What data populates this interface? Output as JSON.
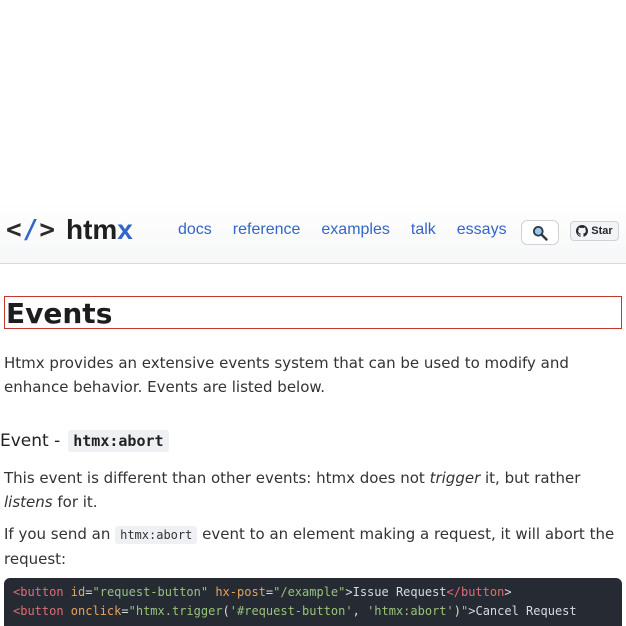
{
  "header": {
    "logo_bracket_open": "<",
    "logo_slash": "/",
    "logo_bracket_close": ">",
    "logo_name_main": "htm",
    "logo_name_accent": "x",
    "nav": [
      "docs",
      "reference",
      "examples",
      "talk",
      "essays"
    ],
    "star_label": "Star",
    "search_icon": "magnifier-icon",
    "github_icon": "github-icon"
  },
  "main": {
    "title": "Events",
    "intro": "Htmx provides an extensive events system that can be used to modify and enhance behavior. Events are listed below.",
    "event": {
      "heading_prefix": "Event -",
      "heading_code": "htmx:abort",
      "desc_part1": "This event is different than other events: htmx does not ",
      "desc_em1": "trigger",
      "desc_part2": " it, but rather ",
      "desc_em2": "listens",
      "desc_part3": " for it.",
      "send_part1": "If you send an ",
      "send_code": "htmx:abort",
      "send_part2": " event to an element making a request, it will abort the request:"
    },
    "code": {
      "line1": {
        "open_tag": "<button",
        "attr1": " id",
        "eq1": "=",
        "val1": "\"request-button\"",
        "attr2": " hx-post",
        "eq2": "=",
        "val2": "\"/example\"",
        "gt": ">",
        "text": "Issue Request",
        "close_tag": "</button",
        "close_gt": ">"
      },
      "line2": {
        "open_tag": "<button",
        "attr1": " onclick",
        "eq1": "=",
        "q_open": "\"",
        "fn": "htmx.trigger",
        "paren_open": "(",
        "arg1": "'#request-button'",
        "comma": ", ",
        "arg2": "'htmx:abort'",
        "paren_close": ")",
        "q_close": "\"",
        "gt": ">",
        "text": "Cancel Request"
      }
    }
  }
}
